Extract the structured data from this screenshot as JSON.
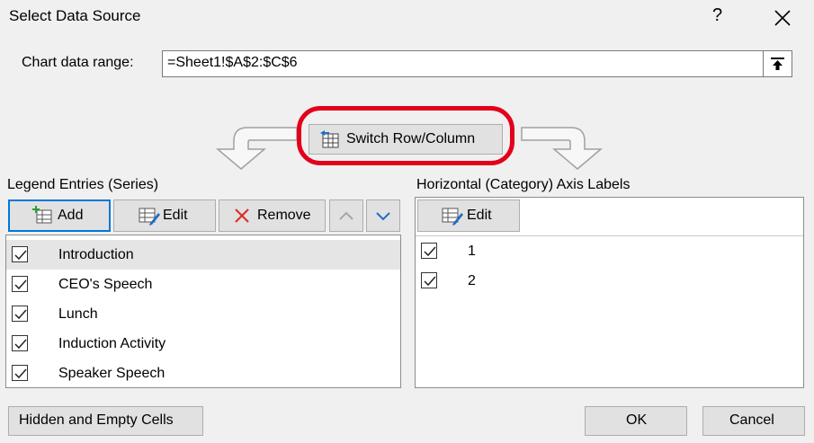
{
  "dialog": {
    "title": "Select Data Source",
    "help": "?"
  },
  "range": {
    "label": "Chart data range:",
    "value": "=Sheet1!$A$2:$C$6"
  },
  "switch": {
    "label": "Switch Row/Column"
  },
  "legend": {
    "label": "Legend Entries (Series)",
    "add": "Add",
    "edit": "Edit",
    "remove": "Remove",
    "items": [
      {
        "label": "Introduction",
        "checked": true,
        "selected": true
      },
      {
        "label": "CEO's Speech",
        "checked": true
      },
      {
        "label": "Lunch",
        "checked": true
      },
      {
        "label": "Induction Activity",
        "checked": true
      },
      {
        "label": "Speaker Speech",
        "checked": true
      }
    ]
  },
  "axis": {
    "label": "Horizontal (Category) Axis Labels",
    "edit": "Edit",
    "items": [
      {
        "label": "1",
        "checked": true
      },
      {
        "label": "2",
        "checked": true
      }
    ]
  },
  "footer": {
    "hidden": "Hidden and Empty Cells",
    "ok": "OK",
    "cancel": "Cancel"
  },
  "colors": {
    "highlight": "#e3001b",
    "selection": "#e5e5e5"
  }
}
